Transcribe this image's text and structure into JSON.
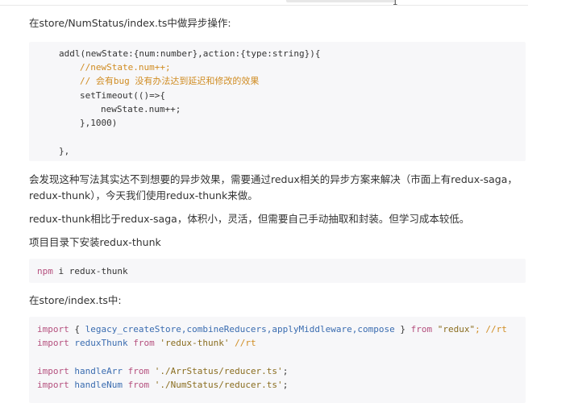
{
  "heading1": "在store/NumStatus/index.ts中做异步操作:",
  "code1": {
    "line1": "addl(newState:{num:number},action:{type:string}){",
    "line2": "//newState.num++;",
    "line3": "// 会有bug 没有办法达到延迟和修改的效果",
    "line4": "setTimeout(()=>{",
    "line5": "newState.num++;",
    "line6": "},1000)",
    "line7": "},"
  },
  "para1_line1": "会发现这种写法其实达不到想要的异步效果，需要通过redux相关的异步方案来解决（市面上有redux-saga，",
  "para1_line2": "redux-thunk），今天我们使用redux-thunk来做。",
  "para2": "redux-thunk相比于redux-saga，体积小，灵活，但需要自己手动抽取和封装。但学习成本较低。",
  "para3": "项目目录下安装redux-thunk",
  "code2": {
    "cmd": "npm",
    "args": " i redux-thunk"
  },
  "heading2": "在store/index.ts中:",
  "code3": {
    "l1_import": "import",
    "l1_brace_open": " { ",
    "l1_names": "legacy_createStore,combineReducers,applyMiddleware,compose",
    "l1_brace_close": " } ",
    "l1_from": "from",
    "l1_src": " \"redux\"",
    "l1_tail": "; //rt",
    "l2_import": "import",
    "l2_name": " reduxThunk ",
    "l2_from": "from",
    "l2_src": " 'redux-thunk'",
    "l2_tail": " //rt",
    "l3_import": "import",
    "l3_name": " handleArr ",
    "l3_from": "from",
    "l3_src": " './ArrStatus/reducer.ts'",
    "l3_tail": ";",
    "l4_import": "import",
    "l4_name": " handleNum ",
    "l4_from": "from",
    "l4_src": " './NumStatus/reducer.ts'",
    "l4_tail": ";"
  },
  "colors": {
    "comment": "#d08c22",
    "keyword": "#b5507e",
    "function": "#3a6cb0",
    "code_bg": "#f7f7f9"
  }
}
